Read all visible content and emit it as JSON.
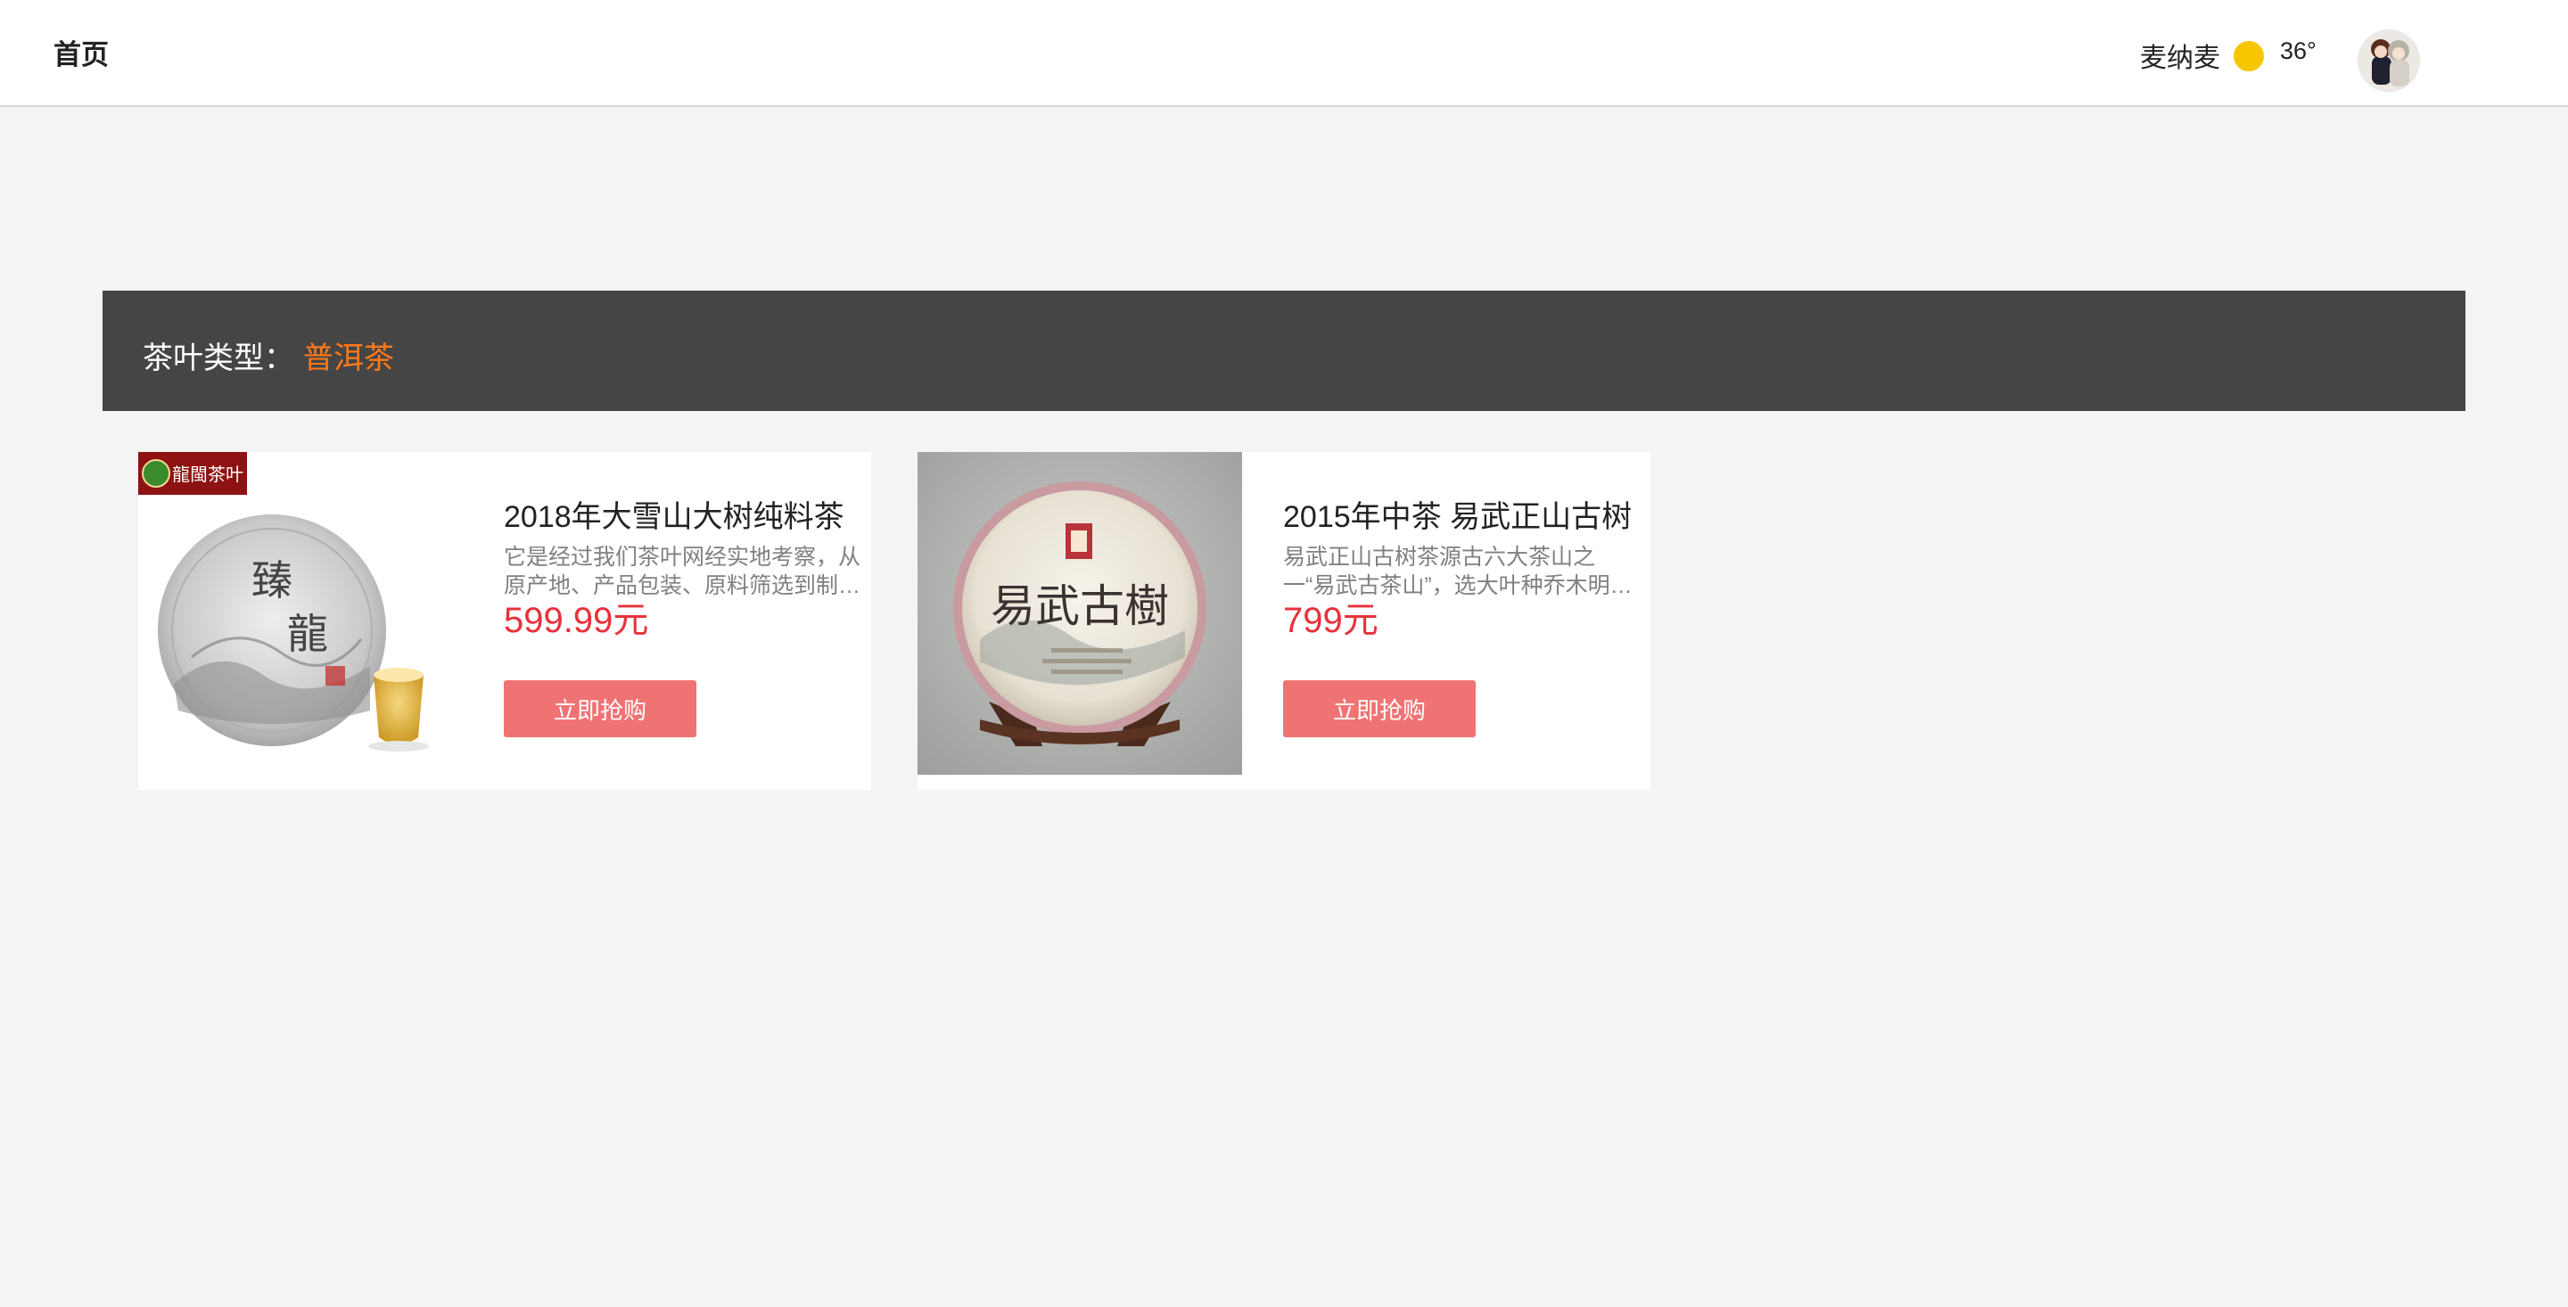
{
  "header": {
    "home_label": "首页",
    "user_name": "麦纳麦",
    "weather_icon": "sun-icon",
    "temperature": "36°"
  },
  "category": {
    "label": "茶叶类型：",
    "value": "普洱茶"
  },
  "products": [
    {
      "title": "2018年大雪山大树纯料茶",
      "description": "它是经过我们茶叶网经实地考察，从原产地、产品包装、原料筛选到制作，…",
      "price": "599.99元",
      "button": "立即抢购",
      "badge_text": "龍閩茶叶",
      "cake_text": "臻龍"
    },
    {
      "title": "2015年中茶 易武正山古树",
      "description": "易武正山古树茶源古六大茶山之一“易武古茶山”，选大叶种乔木明前春蕊…",
      "price": "799元",
      "button": "立即抢购",
      "cake_text": "易武古樹"
    }
  ]
}
